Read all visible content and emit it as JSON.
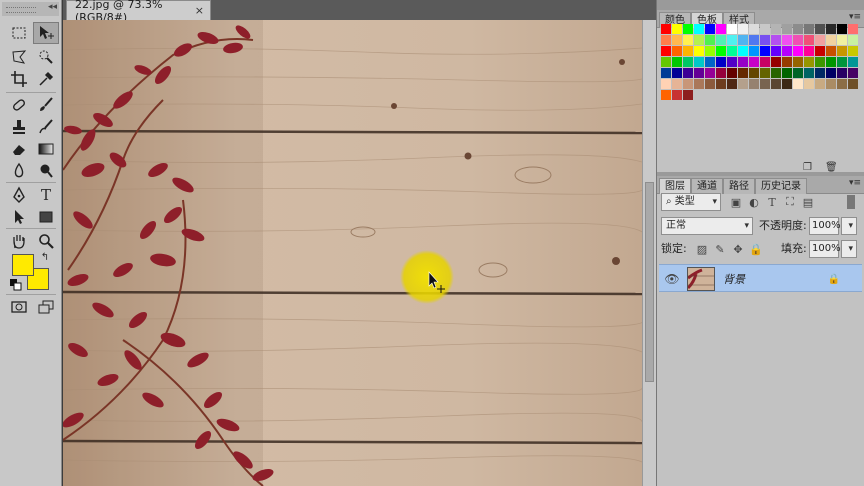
{
  "document": {
    "tab_title": "22.jpg @ 73.3%(RGB/8#)",
    "close_glyph": "×"
  },
  "toolbox": {
    "collapse_glyph": "◂◂",
    "tools": [
      "rect-marquee",
      "move",
      "lasso",
      "quick-select",
      "crop",
      "eyedropper",
      "spot-heal",
      "brush",
      "clone-stamp",
      "history-brush",
      "eraser",
      "gradient",
      "blur",
      "dodge",
      "pen",
      "type",
      "path-select",
      "rectangle",
      "hand",
      "zoom"
    ],
    "foreground_color": "#ffea00",
    "background_color": "#ffea00"
  },
  "swatches_panel": {
    "tabs": [
      "颜色",
      "色板",
      "样式"
    ],
    "active_tab": "色板",
    "menu_glyph": "▾≡",
    "colors": [
      "#ff0000",
      "#ffff00",
      "#00ff00",
      "#00ffff",
      "#0000ff",
      "#ff00ff",
      "#ffffff",
      "#f0f0f0",
      "#dcdcdc",
      "#c8c8c8",
      "#b4b4b4",
      "#a0a0a0",
      "#8c8c8c",
      "#787878",
      "#505050",
      "#282828",
      "#000000",
      "#ff6e6e",
      "#ff7d4b",
      "#ffb950",
      "#fff050",
      "#b4f050",
      "#50f050",
      "#50f0b4",
      "#50f0f0",
      "#50b4f0",
      "#5078f0",
      "#7850f0",
      "#b450f0",
      "#f050f0",
      "#f050b4",
      "#f05078",
      "#f0a0a0",
      "#f0d2a0",
      "#f0f0a0",
      "#c8f0a0",
      "#ff0000",
      "#ff6400",
      "#ffb400",
      "#ffff00",
      "#96ff00",
      "#00ff00",
      "#00ff96",
      "#00ffff",
      "#0096ff",
      "#0000ff",
      "#6400ff",
      "#b400ff",
      "#ff00ff",
      "#ff0096",
      "#c80000",
      "#c85000",
      "#c89600",
      "#c8c800",
      "#64c800",
      "#00c800",
      "#00c864",
      "#00c8c8",
      "#0064c8",
      "#0000c8",
      "#5000c8",
      "#9600c8",
      "#c800c8",
      "#c80064",
      "#960000",
      "#963c00",
      "#966400",
      "#969600",
      "#3c9600",
      "#009600",
      "#00963c",
      "#009696",
      "#003c96",
      "#000096",
      "#3c0096",
      "#640096",
      "#960096",
      "#96003c",
      "#640000",
      "#642800",
      "#644600",
      "#646400",
      "#286400",
      "#006400",
      "#006428",
      "#006464",
      "#002864",
      "#000064",
      "#280064",
      "#460064",
      "#ffd2b4",
      "#e6b496",
      "#c89678",
      "#aa785a",
      "#8c5a3c",
      "#6e3c1e",
      "#502814",
      "#b4a08c",
      "#968270",
      "#786450",
      "#5a4632",
      "#3c2814",
      "#ffe6c8",
      "#e6c8a0",
      "#c8aa82",
      "#aa8c64",
      "#8c6e46",
      "#6e5028",
      "#ff6400",
      "#c83232",
      "#8c1e1e"
    ],
    "footer_icons": [
      "new-swatch-icon",
      "trash-icon"
    ]
  },
  "layers_panel": {
    "tabs": [
      "图层",
      "通道",
      "路径",
      "历史记录"
    ],
    "active_tab": "图层",
    "menu_glyph": "▾≡",
    "filter_label": "类型",
    "blend_mode": "正常",
    "opacity_label": "不透明度:",
    "opacity_value": "100%",
    "lock_label": "锁定:",
    "fill_label": "填充:",
    "fill_value": "100%",
    "layers": [
      {
        "name": "背景",
        "visible": true,
        "locked": true
      }
    ]
  }
}
